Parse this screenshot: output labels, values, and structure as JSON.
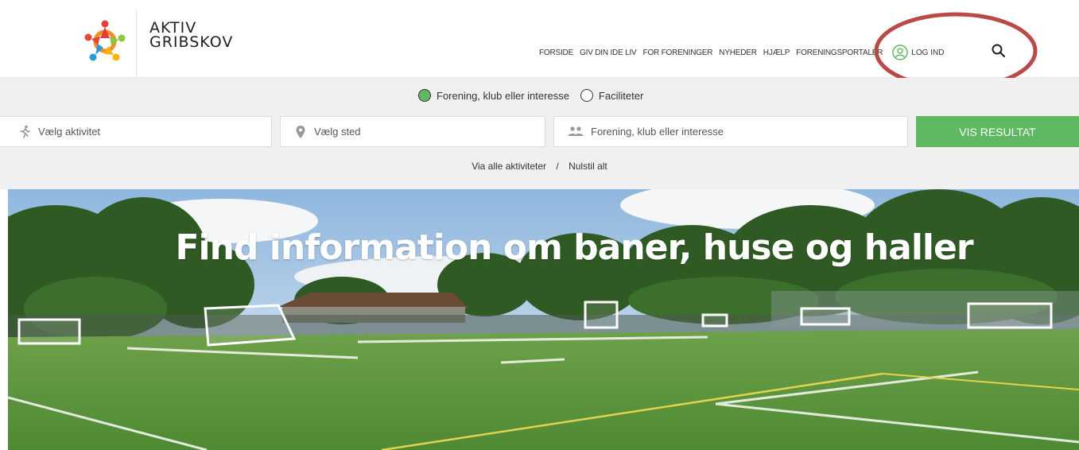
{
  "brand": {
    "line1": "AKTIV",
    "line2": "GRIBSKOV"
  },
  "nav": {
    "items": [
      "FORSIDE",
      "GIV DIN IDE LIV",
      "FOR FORENINGER",
      "NYHEDER",
      "HJÆLP",
      "FORENINGSPORTALER"
    ],
    "login_label": "LOG IND"
  },
  "filters": {
    "options": [
      "Forening, klub eller interesse",
      "Faciliteter"
    ],
    "selected": "Forening, klub eller interesse"
  },
  "search": {
    "activity_placeholder": "Vælg aktivitet",
    "place_placeholder": "Vælg sted",
    "club_placeholder": "Forening, klub eller interesse",
    "submit_label": "VIS RESULTAT"
  },
  "links": {
    "all_activities": "Via alle aktiviteter",
    "separator": "/",
    "reset": "Nulstil alt"
  },
  "hero": {
    "title": "Find information om baner, huse og haller"
  },
  "colors": {
    "accent": "#5fb862",
    "annotation": "#b94a48"
  },
  "icons": [
    "logo-icon",
    "user-icon",
    "search-icon",
    "running-person-icon",
    "map-pin-icon",
    "people-icon"
  ]
}
